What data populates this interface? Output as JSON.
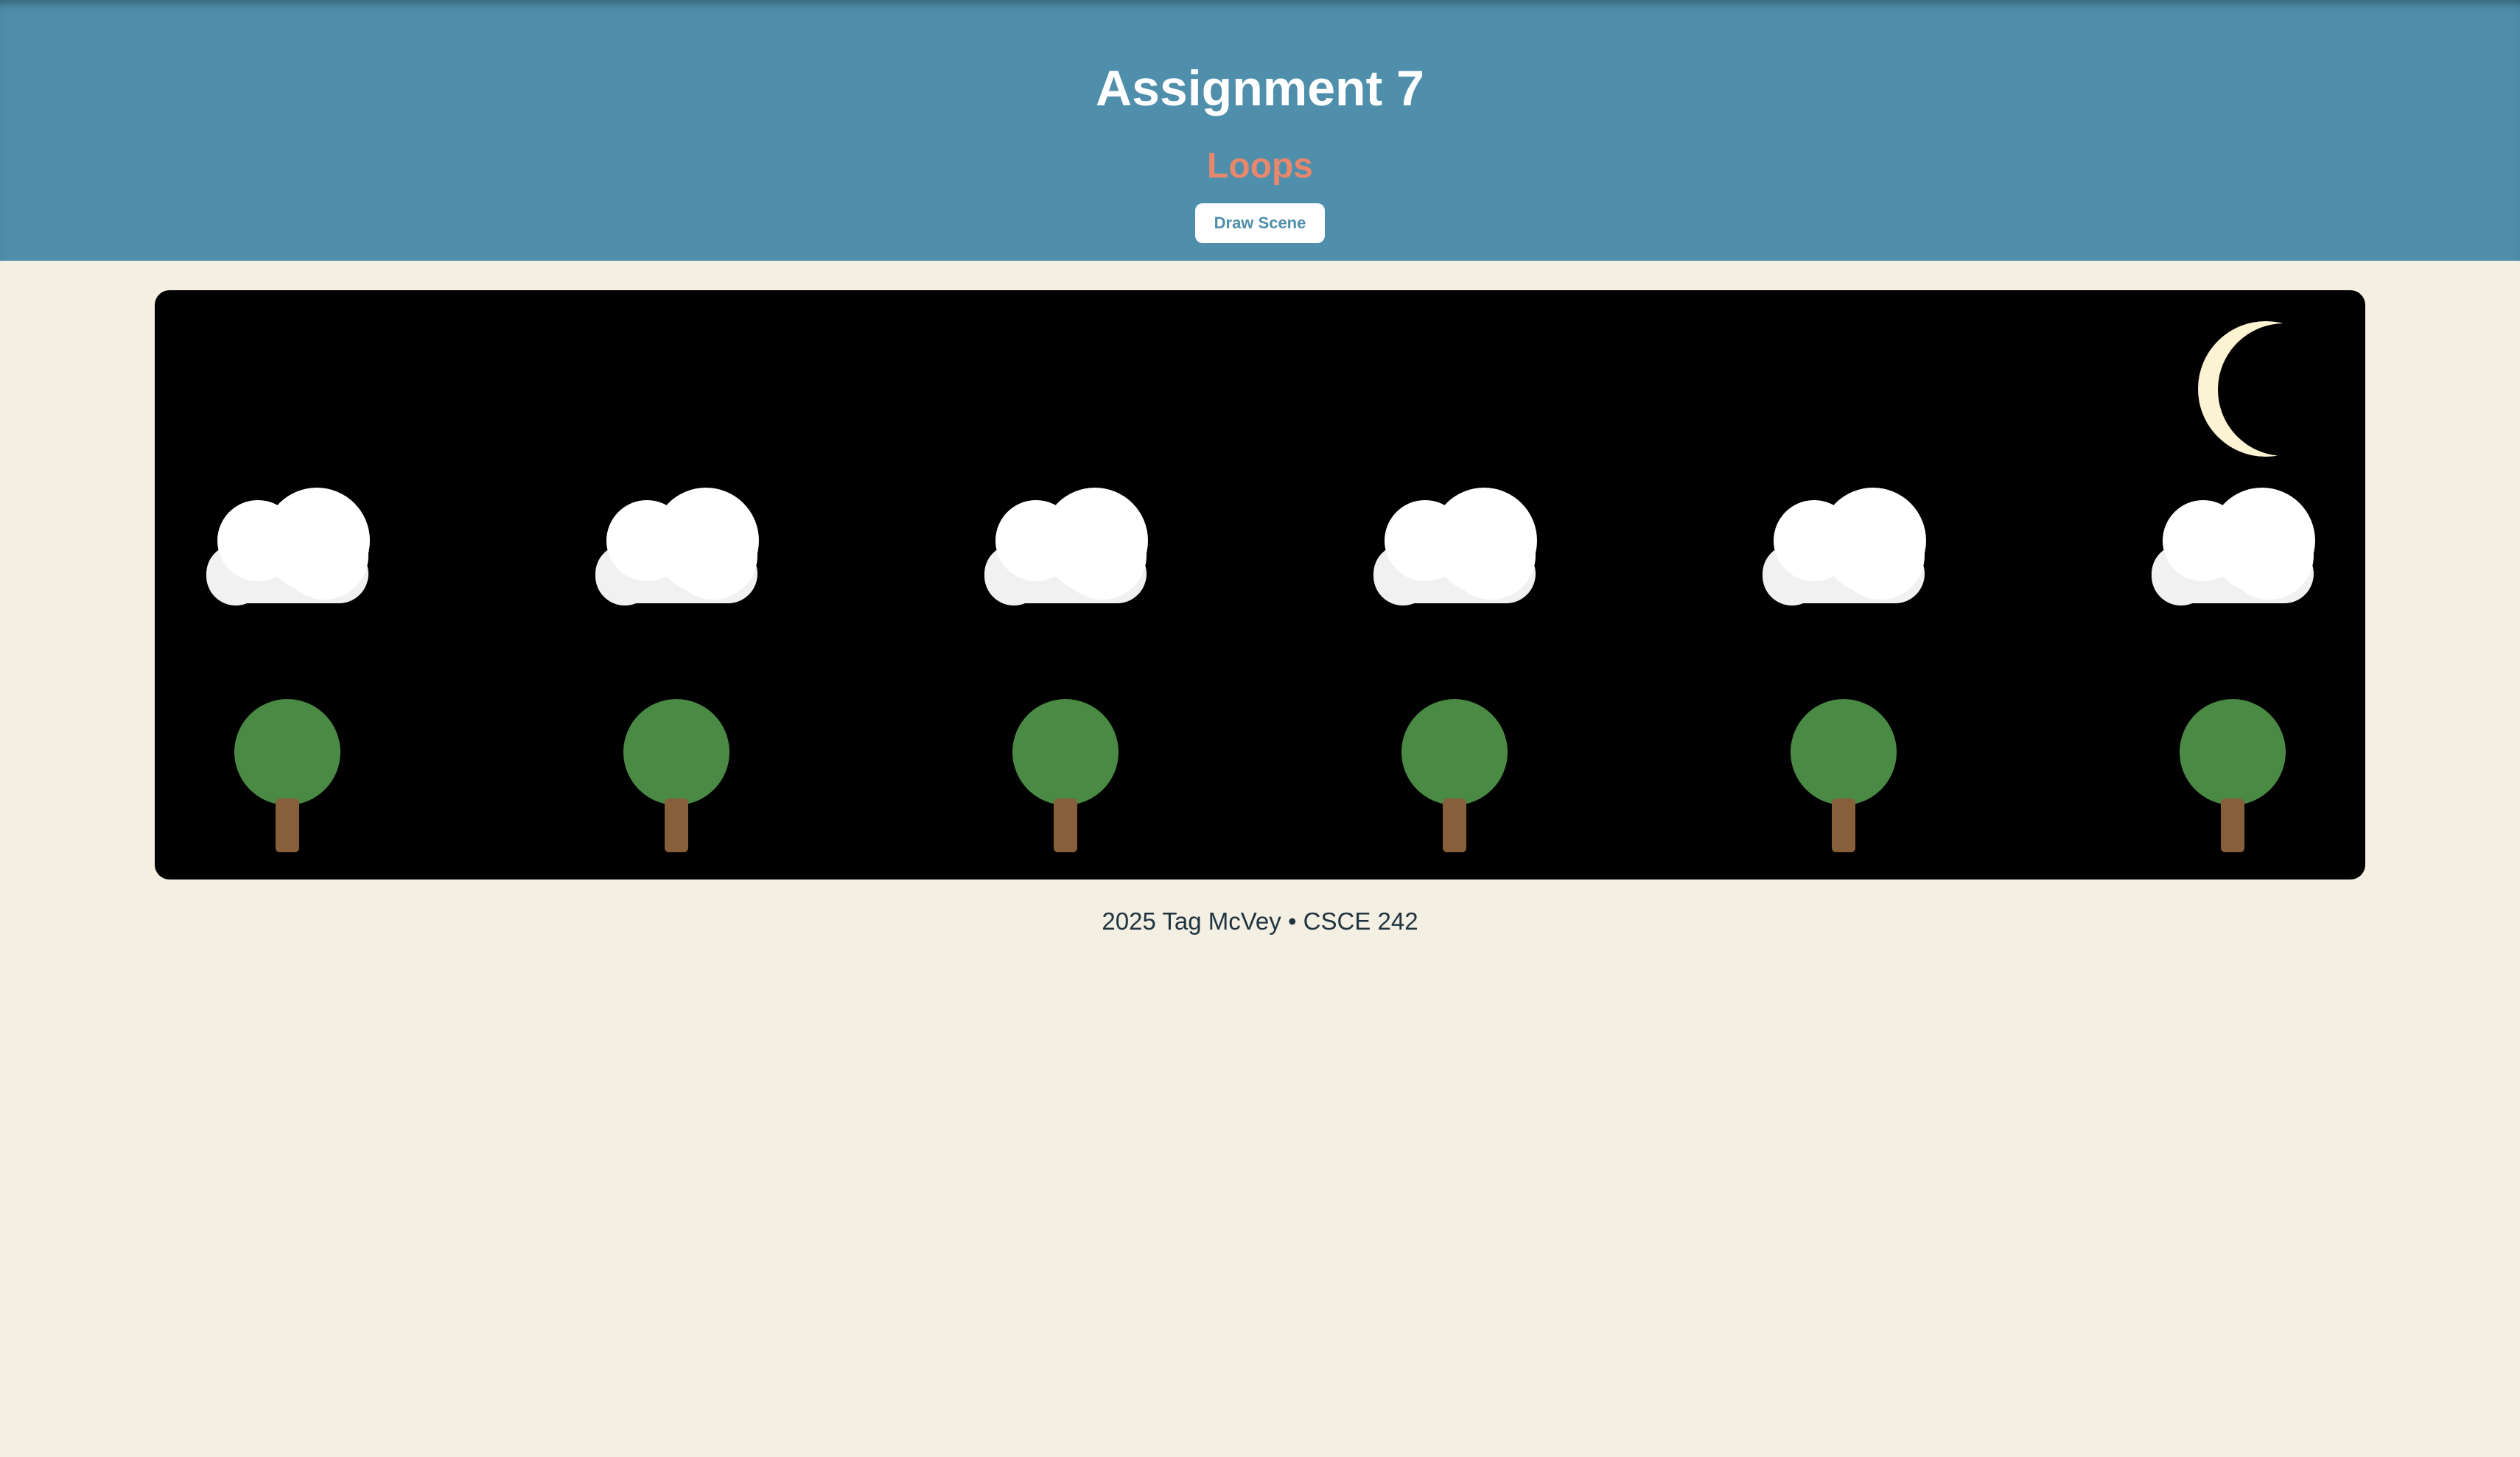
{
  "header": {
    "title": "Assignment 7",
    "subtitle": "Loops",
    "draw_button_label": "Draw Scene"
  },
  "scene": {
    "background_color": "#000000",
    "moon": {
      "icon": "crescent-moon-icon",
      "color": "#fbf3d2"
    },
    "cloud": {
      "icon": "cloud-icon",
      "color": "#ffffff",
      "shade_color": "#f1f1f1",
      "count": 6
    },
    "tree": {
      "icon": "tree-icon",
      "canopy_color": "#4a8a44",
      "trunk_color": "#875f3b",
      "count": 6
    }
  },
  "footer": {
    "text": "2025 Tag McVey • CSCE 242"
  },
  "colors": {
    "header_bg": "#4f8fab",
    "page_bg": "#f4efe3",
    "subtitle": "#e8876c"
  }
}
